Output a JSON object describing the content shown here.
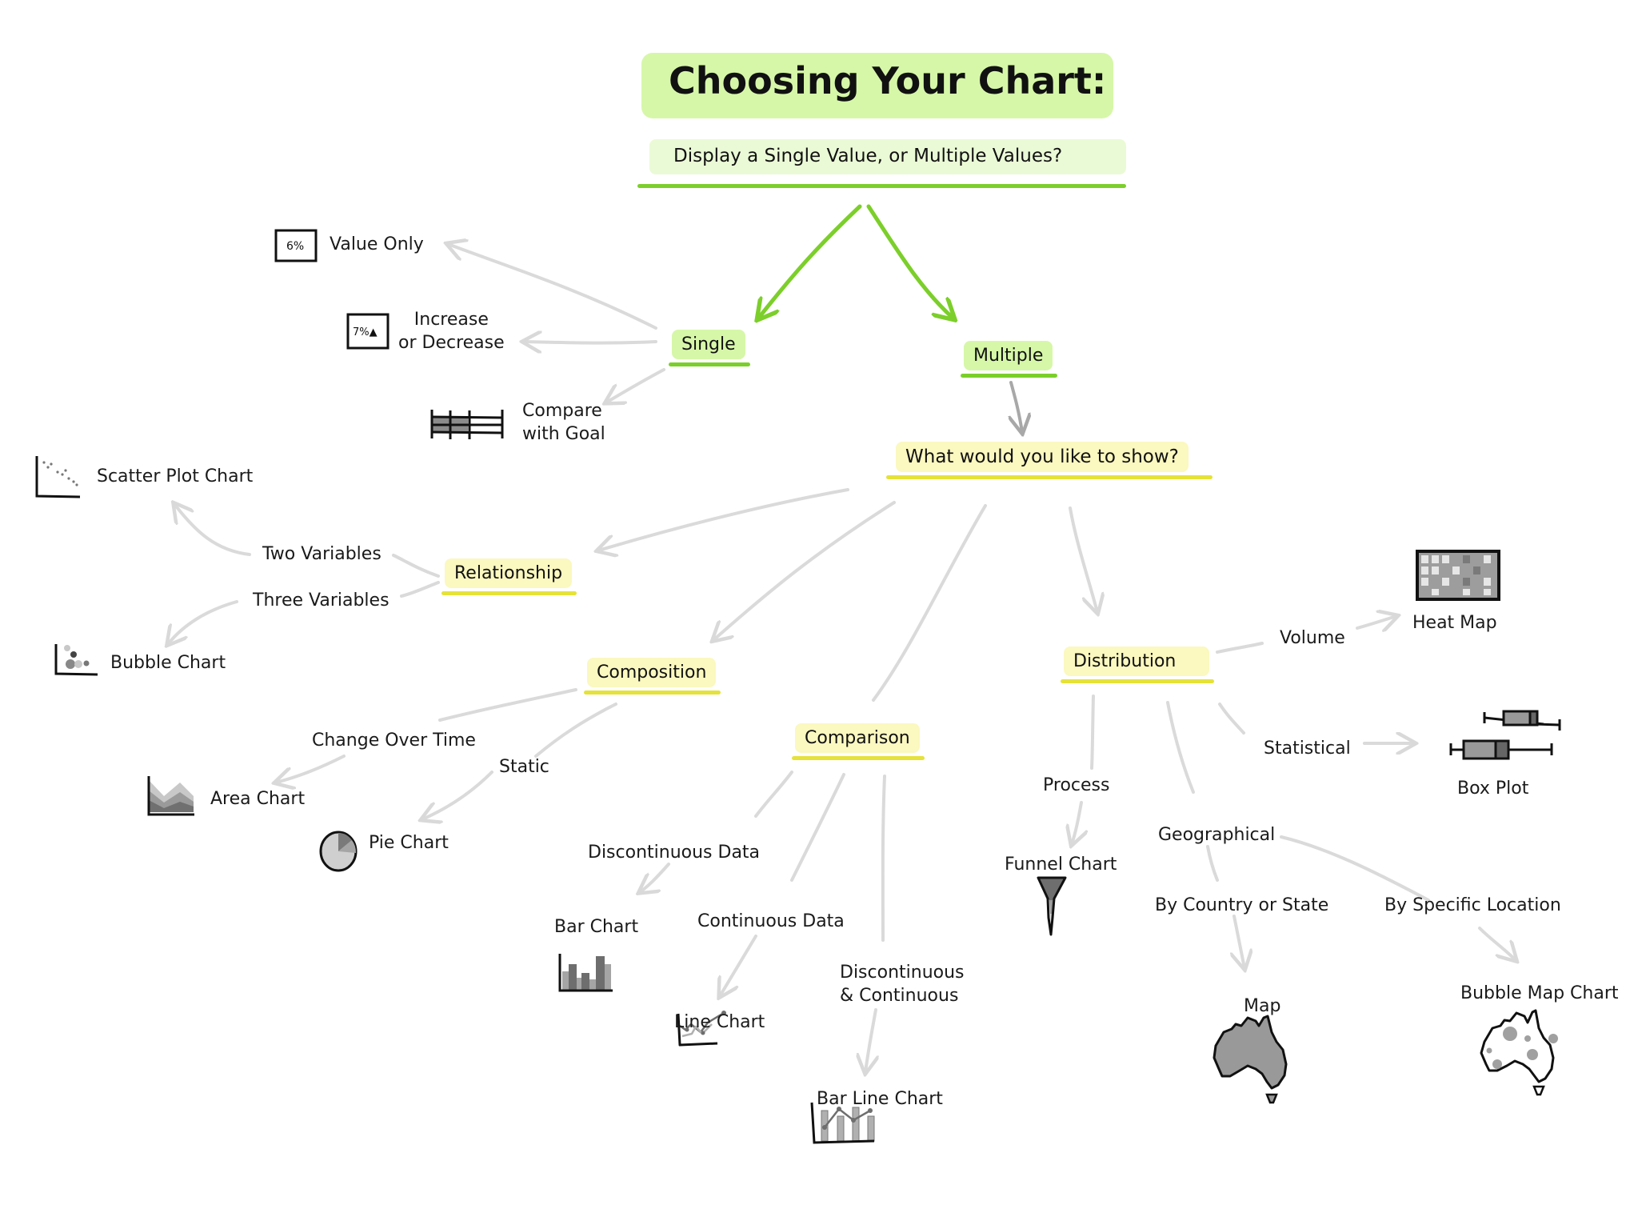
{
  "header": {
    "title": "Choosing Your Chart:",
    "question": "Display a Single Value, or Multiple Values?"
  },
  "colors": {
    "green_fill": "#d6f7a8",
    "green_line": "#7ccf2a",
    "yellow_fill": "#fbf8c0",
    "yellow_line": "#e5e23a",
    "connector": "#d9d9d9",
    "icon_gray": "#8c8c8c"
  },
  "branches": {
    "single": {
      "label": "Single",
      "outcomes": [
        {
          "label": "Value Only",
          "icon": "value-box-icon",
          "icon_text": "6%"
        },
        {
          "label": "Increase\nor Decrease",
          "icon": "value-change-box-icon",
          "icon_text": "7%▲"
        },
        {
          "label": "Compare\nwith Goal",
          "icon": "progress-bar-icon"
        }
      ]
    },
    "multiple": {
      "label": "Multiple",
      "question": "What would you like to show?",
      "categories": {
        "relationship": {
          "label": "Relationship",
          "options": [
            {
              "condition": "Two Variables",
              "chart": "Scatter Plot Chart",
              "icon": "scatter-plot-icon"
            },
            {
              "condition": "Three Variables",
              "chart": "Bubble Chart",
              "icon": "bubble-chart-icon"
            }
          ]
        },
        "composition": {
          "label": "Composition",
          "options": [
            {
              "condition": "Change Over Time",
              "chart": "Area Chart",
              "icon": "area-chart-icon"
            },
            {
              "condition": "Static",
              "chart": "Pie Chart",
              "icon": "pie-chart-icon"
            }
          ]
        },
        "comparison": {
          "label": "Comparison",
          "options": [
            {
              "condition": "Discontinuous Data",
              "chart": "Bar Chart",
              "icon": "bar-chart-icon"
            },
            {
              "condition": "Continuous Data",
              "chart": "Line Chart",
              "icon": "line-chart-icon"
            },
            {
              "condition": "Discontinuous\n& Continuous",
              "chart": "Bar Line Chart",
              "icon": "bar-line-chart-icon"
            }
          ]
        },
        "distribution": {
          "label": "Distribution",
          "options": [
            {
              "condition": "Volume",
              "chart": "Heat Map",
              "icon": "heat-map-icon"
            },
            {
              "condition": "Statistical",
              "chart": "Box Plot",
              "icon": "box-plot-icon"
            },
            {
              "condition": "Process",
              "chart": "Funnel Chart",
              "icon": "funnel-chart-icon"
            },
            {
              "condition": "Geographical",
              "sub_options": [
                {
                  "condition": "By Country or State",
                  "chart": "Map",
                  "icon": "choropleth-map-icon"
                },
                {
                  "condition": "By Specific Location",
                  "chart": "Bubble Map Chart",
                  "icon": "bubble-map-icon"
                }
              ]
            }
          ]
        }
      }
    }
  }
}
